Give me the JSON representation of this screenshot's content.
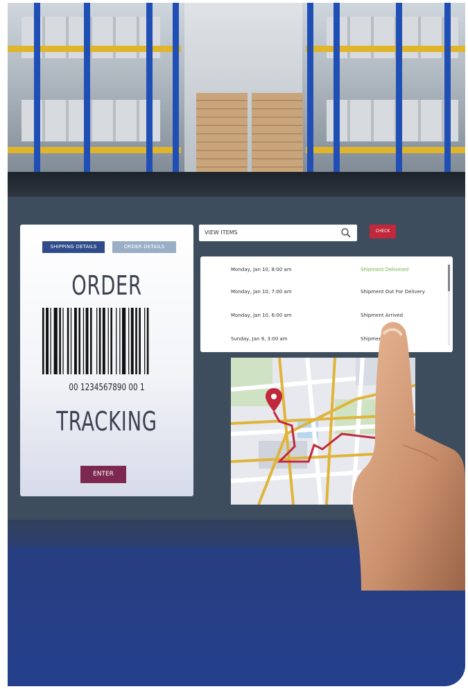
{
  "order_panel": {
    "tabs": [
      {
        "label": "SHIPPING DETAILS",
        "active": true
      },
      {
        "label": "ORDER DETAILS",
        "active": false
      }
    ],
    "title": "ORDER",
    "barcode_number": "00 1234567890 00 1",
    "subtitle": "TRACKING",
    "enter_label": "ENTER"
  },
  "search": {
    "placeholder": "VIEW ITEMS",
    "check_label": "CHECK"
  },
  "shipments": [
    {
      "time": "Monday, Jan 10, 8:00 am",
      "status": "Shipment Delivered"
    },
    {
      "time": "Monday, Jan 10, 7:00 am",
      "status": "Shipment Out For Delivery"
    },
    {
      "time": "Monday, Jan 10, 6:00 am",
      "status": "Shipment Arrived"
    },
    {
      "time": "Sunday, Jan 9, 3:00 am",
      "status": "Shipment ... Hub"
    }
  ],
  "colors": {
    "primary_blue": "#2f4b8a",
    "enter_maroon": "#7d2850",
    "check_red": "#c0283c",
    "delivered_green": "#6cb63f",
    "map_route": "#c0283c"
  }
}
